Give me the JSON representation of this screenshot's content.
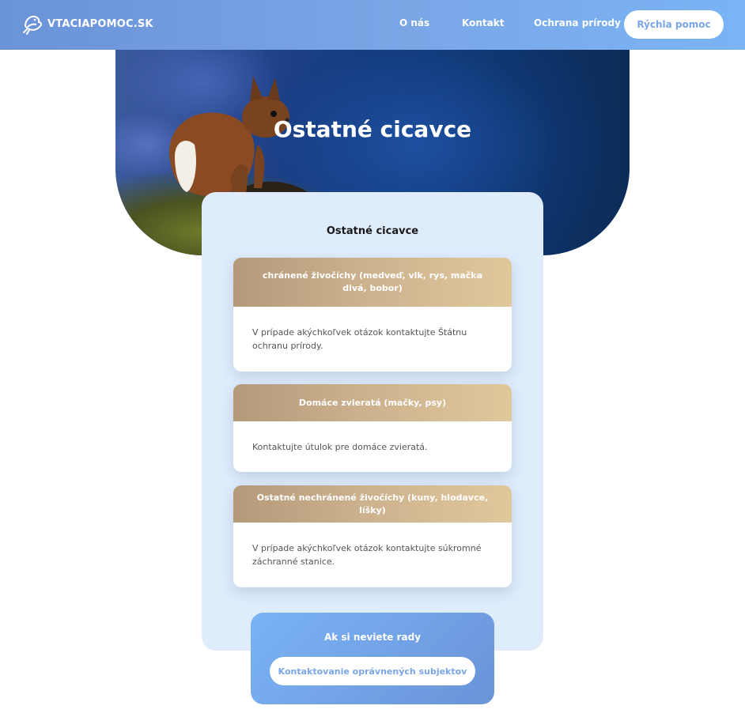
{
  "header": {
    "logo_text": "VTACIAPOMOC.SK",
    "logo_icon": "bird-hand-icon",
    "nav": [
      {
        "label": "O nás"
      },
      {
        "label": "Kontakt"
      },
      {
        "label": "Ochrana prírody"
      }
    ],
    "cta_label": "Rýchla pomoc"
  },
  "hero": {
    "title": "Ostatné cicavce",
    "image": "squirrel-photo"
  },
  "panel": {
    "title": "Ostatné cicavce",
    "cards": [
      {
        "heading": "chránené živočíchy (medveď, vlk, rys, mačka divá, bobor)",
        "body": "V prípade akýchkoľvek otázok kontaktujte Štátnu ochranu prírody."
      },
      {
        "heading": "Domáce zvieratá (mačky, psy)",
        "body": "Kontaktujte útulok pre domáce zvieratá."
      },
      {
        "heading": "Ostatné nechránené živočíchy (kuny, hlodavce, líšky)",
        "body": "V prípade akýchkoľvek otázok kontaktujte súkromné záchranné stanice."
      }
    ]
  },
  "help": {
    "title": "Ak si neviete rady",
    "button_label": "Kontaktovanie oprávnených subjektov"
  },
  "colors": {
    "header_start": "#6b93d8",
    "header_end": "#7ab4f5",
    "card_head": "#cdb38e",
    "panel_bg": "#deecfc"
  }
}
